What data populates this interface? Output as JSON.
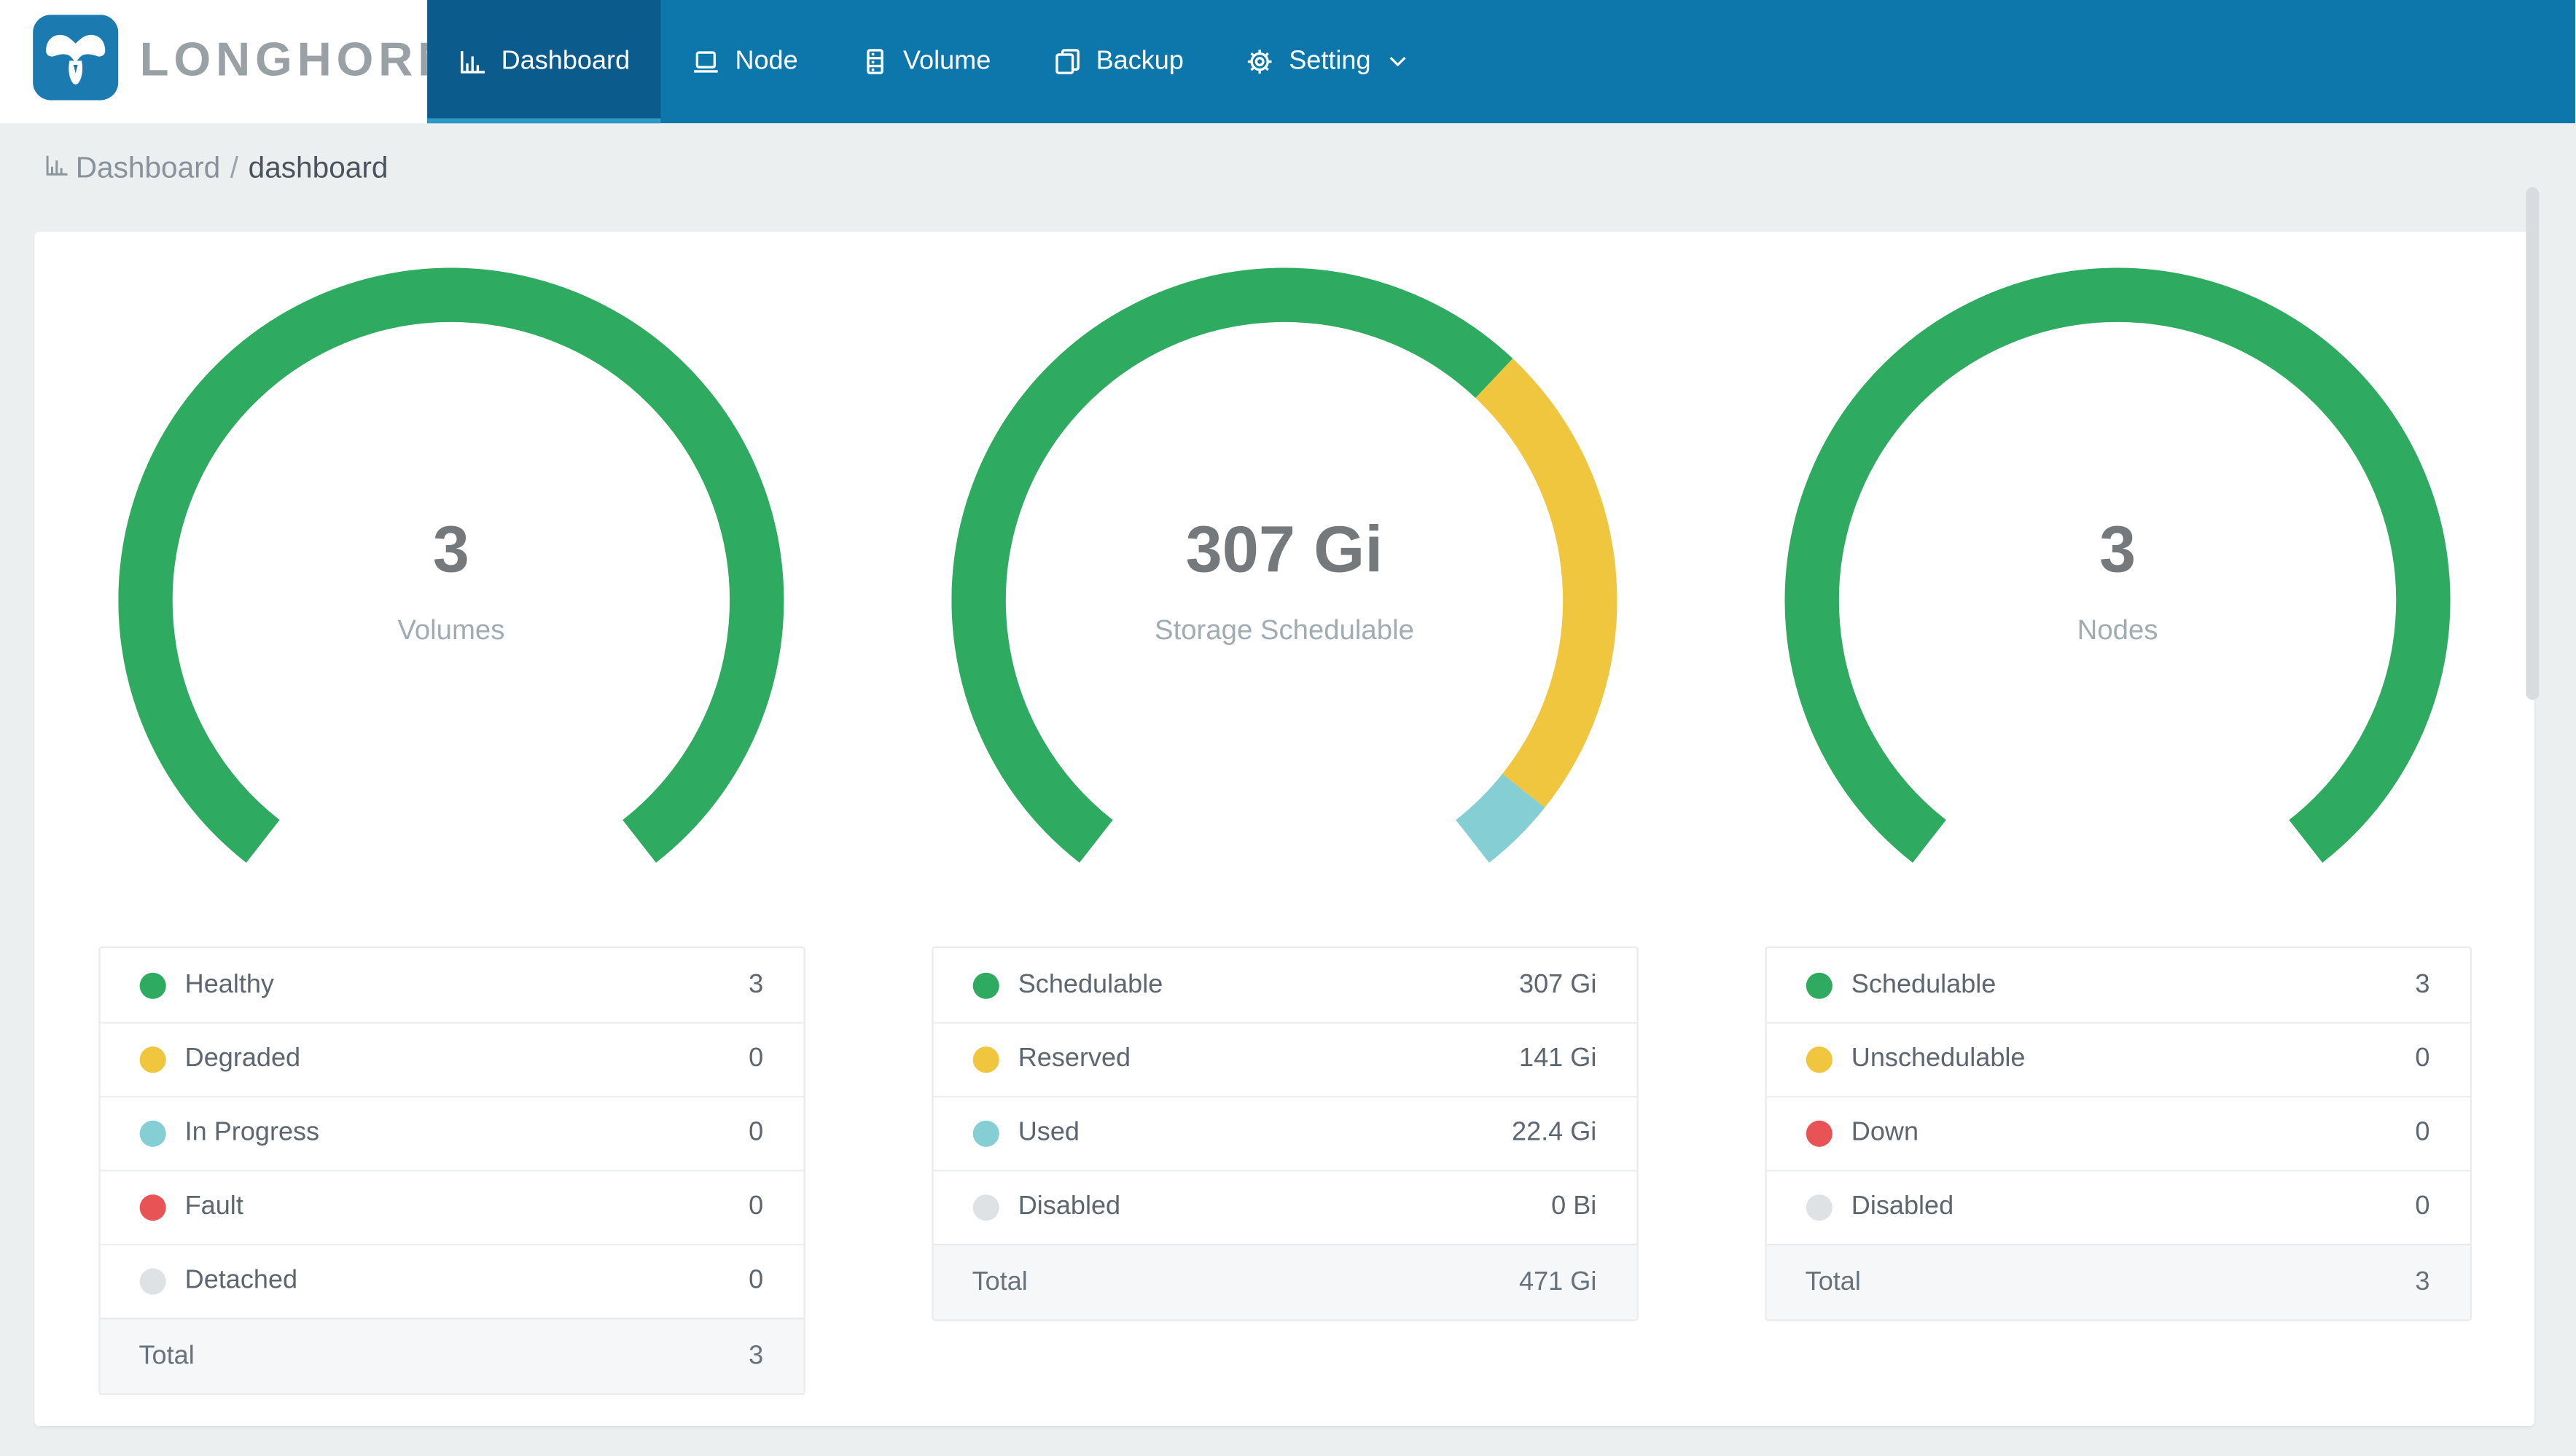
{
  "brand": {
    "name": "LONGHORN"
  },
  "nav": {
    "items": [
      {
        "label": "Dashboard",
        "icon": "bar-chart-icon",
        "active": true
      },
      {
        "label": "Node",
        "icon": "laptop-icon",
        "active": false
      },
      {
        "label": "Volume",
        "icon": "server-icon",
        "active": false
      },
      {
        "label": "Backup",
        "icon": "copy-icon",
        "active": false
      },
      {
        "label": "Setting",
        "icon": "gear-icon",
        "active": false,
        "has_dropdown": true
      }
    ]
  },
  "breadcrumb": {
    "section": "Dashboard",
    "separator": "/",
    "page": "dashboard"
  },
  "colors": {
    "green": "#2faa61",
    "yellow": "#f0c63f",
    "teal": "#84ced4",
    "red": "#e85456",
    "gray": "#dfe2e5",
    "nav_blue": "#0d76ab",
    "nav_active_blue": "#0b5c8d",
    "nav_underline": "#2b9ac5",
    "logo_blue": "#1b7ab0"
  },
  "chart_data": [
    {
      "type": "gauge-donut",
      "center_value": "3",
      "center_label": "Volumes",
      "start_angle": 232,
      "end_angle": -52,
      "segments": [
        {
          "name": "Healthy",
          "color": "green",
          "value": 3,
          "display": "3"
        },
        {
          "name": "Degraded",
          "color": "yellow",
          "value": 0,
          "display": "0"
        },
        {
          "name": "In Progress",
          "color": "teal",
          "value": 0,
          "display": "0"
        },
        {
          "name": "Fault",
          "color": "red",
          "value": 0,
          "display": "0"
        },
        {
          "name": "Detached",
          "color": "gray",
          "value": 0,
          "display": "0"
        }
      ],
      "total_label": "Total",
      "total_display": "3"
    },
    {
      "type": "gauge-donut",
      "center_value": "307 Gi",
      "center_label": "Storage Schedulable",
      "start_angle": 232,
      "end_angle": -52,
      "segments": [
        {
          "name": "Schedulable",
          "color": "green",
          "value": 307,
          "display": "307 Gi"
        },
        {
          "name": "Reserved",
          "color": "yellow",
          "value": 141,
          "display": "141 Gi"
        },
        {
          "name": "Used",
          "color": "teal",
          "value": 22.4,
          "display": "22.4 Gi"
        },
        {
          "name": "Disabled",
          "color": "gray",
          "value": 0,
          "display": "0 Bi"
        }
      ],
      "total_label": "Total",
      "total_display": "471 Gi"
    },
    {
      "type": "gauge-donut",
      "center_value": "3",
      "center_label": "Nodes",
      "start_angle": 232,
      "end_angle": -52,
      "segments": [
        {
          "name": "Schedulable",
          "color": "green",
          "value": 3,
          "display": "3"
        },
        {
          "name": "Unschedulable",
          "color": "yellow",
          "value": 0,
          "display": "0"
        },
        {
          "name": "Down",
          "color": "red",
          "value": 0,
          "display": "0"
        },
        {
          "name": "Disabled",
          "color": "gray",
          "value": 0,
          "display": "0"
        }
      ],
      "total_label": "Total",
      "total_display": "3"
    }
  ]
}
